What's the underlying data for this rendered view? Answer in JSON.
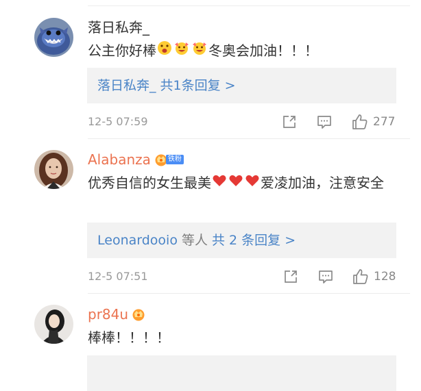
{
  "comments": [
    {
      "username": "落日私奔_",
      "text_before": "公主你好棒",
      "text_after": "冬奥会加油！！！",
      "reply_who": "落日私奔_",
      "reply_total": "共1条回复 >",
      "time": "12-5 07:59",
      "likes": "277"
    },
    {
      "username": "Alabanza",
      "fan_badge": "铁粉",
      "text_before": "优秀自信的女生最美",
      "text_after": "爱凌加油，注意安全",
      "reply_who": "Leonardooio",
      "reply_suffix": " 等人",
      "reply_total": "共 2 条回复 >",
      "time": "12-5 07:51",
      "likes": "128"
    },
    {
      "username": "pr84u",
      "text": "棒棒！！！！"
    }
  ],
  "icons": {
    "share": "share-icon",
    "comment": "comment-icon",
    "like": "thumbs-up-icon",
    "member": "crown-badge-icon",
    "emoji_wow": "wow-emoji-icon",
    "emoji_cry": "cheering-emoji-icon",
    "heart": "red-heart-icon"
  },
  "colors": {
    "username_accent": "#eb7350",
    "reply_link": "#4a84c7",
    "reply_bg": "#f2f2f2",
    "meta": "#999999",
    "fan_tag": "#4a8df5"
  }
}
